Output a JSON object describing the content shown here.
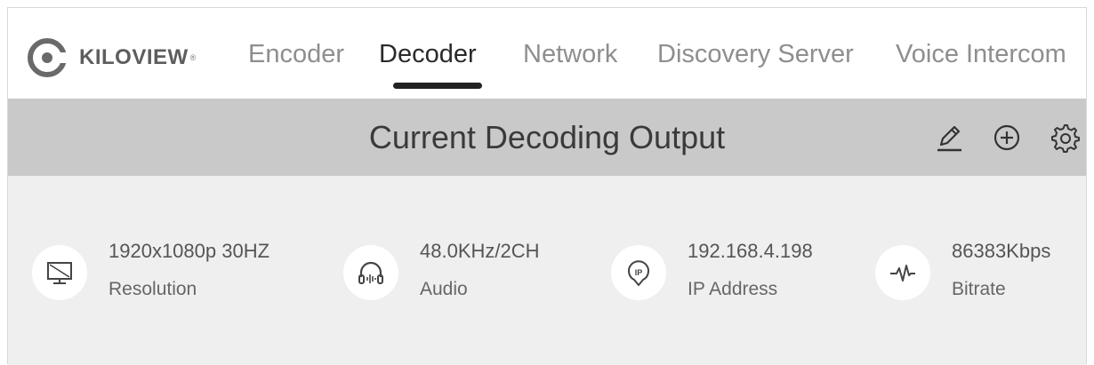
{
  "brand": {
    "name": "KILOVIEW",
    "reg": "®"
  },
  "nav": {
    "tabs": [
      {
        "label": "Encoder",
        "active": false
      },
      {
        "label": "Decoder",
        "active": true
      },
      {
        "label": "Network",
        "active": false
      },
      {
        "label": "Discovery Server",
        "active": false
      },
      {
        "label": "Voice Intercom",
        "active": false
      }
    ]
  },
  "header": {
    "title": "Current Decoding Output",
    "actions": [
      "edit-icon",
      "add-circle-icon",
      "settings-icon"
    ]
  },
  "info": [
    {
      "value": "1920x1080p 30HZ",
      "label": "Resolution",
      "icon": "monitor-icon"
    },
    {
      "value": "48.0KHz/2CH",
      "label": "Audio",
      "icon": "headphones-icon"
    },
    {
      "value": "192.168.4.198",
      "label": "IP Address",
      "icon": "ip-pin-icon"
    },
    {
      "value": "86383Kbps",
      "label": "Bitrate",
      "icon": "waveform-icon"
    }
  ],
  "colors": {
    "title_bar_bg": "#c9c9c9",
    "content_bg": "#efefef",
    "active_tab": "#2a2a2a",
    "inactive_tab": "#8e8e8e"
  }
}
